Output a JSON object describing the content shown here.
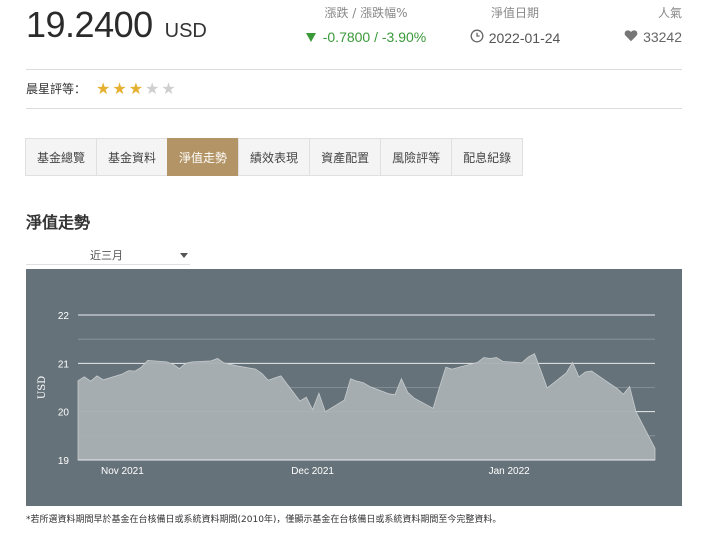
{
  "header": {
    "price": "19.2400",
    "currency": "USD",
    "change_label": "漲跌 / 漲跌幅%",
    "change_value": "-0.7800 / -3.90%",
    "date_label": "淨值日期",
    "date_value": "2022-01-24",
    "popularity_label": "人氣",
    "popularity_value": "33242"
  },
  "rating": {
    "label": "晨星評等：",
    "stars": 3,
    "max_stars": 5
  },
  "tabs": [
    {
      "label": "基金總覽",
      "active": false
    },
    {
      "label": "基金資料",
      "active": false
    },
    {
      "label": "淨值走勢",
      "active": true
    },
    {
      "label": "績效表現",
      "active": false
    },
    {
      "label": "資產配置",
      "active": false
    },
    {
      "label": "風險評等",
      "active": false
    },
    {
      "label": "配息紀錄",
      "active": false
    }
  ],
  "section_title": "淨值走勢",
  "range_select": {
    "value": "近三月"
  },
  "footnote": "*若所選資料期間早於基金在台核備日或系統資料期間(2010年)，僅顯示基金在台核備日或系統資料期間至今完整資料。",
  "colors": {
    "accent": "#b39466",
    "chart_bg": "#667279",
    "area_fill": "#a9b0b4",
    "up_down_green": "#3a9a3a",
    "star_on": "#e6b030"
  },
  "chart_data": {
    "type": "area",
    "ylabel": "USD",
    "ylim": [
      19,
      22
    ],
    "y_ticks": [
      19,
      20,
      21,
      22
    ],
    "x_tick_labels": [
      {
        "label": "Nov 2021",
        "date": "2021-11-01"
      },
      {
        "label": "Dec 2021",
        "date": "2021-12-01"
      },
      {
        "label": "Jan 2022",
        "date": "2022-01-01"
      }
    ],
    "x_range": [
      "2021-10-25",
      "2022-01-24"
    ],
    "grid": true,
    "series": [
      {
        "x": [
          "2021-10-25",
          "2021-10-26",
          "2021-10-27",
          "2021-10-28",
          "2021-10-29",
          "2021-11-01",
          "2021-11-02",
          "2021-11-03",
          "2021-11-04",
          "2021-11-05",
          "2021-11-08",
          "2021-11-09",
          "2021-11-10",
          "2021-11-11",
          "2021-11-12",
          "2021-11-15",
          "2021-11-16",
          "2021-11-17",
          "2021-11-18",
          "2021-11-19",
          "2021-11-22",
          "2021-11-23",
          "2021-11-24",
          "2021-11-26",
          "2021-11-29",
          "2021-11-30",
          "2021-12-01",
          "2021-12-02",
          "2021-12-03",
          "2021-12-06",
          "2021-12-07",
          "2021-12-08",
          "2021-12-09",
          "2021-12-10",
          "2021-12-13",
          "2021-12-14",
          "2021-12-15",
          "2021-12-16",
          "2021-12-17",
          "2021-12-20",
          "2021-12-21",
          "2021-12-22",
          "2021-12-23",
          "2021-12-27",
          "2021-12-28",
          "2021-12-29",
          "2021-12-30",
          "2021-12-31",
          "2022-01-03",
          "2022-01-04",
          "2022-01-05",
          "2022-01-06",
          "2022-01-07",
          "2022-01-10",
          "2022-01-11",
          "2022-01-12",
          "2022-01-13",
          "2022-01-14",
          "2022-01-18",
          "2022-01-19",
          "2022-01-20",
          "2022-01-21",
          "2022-01-24"
        ],
        "values": [
          20.64,
          20.72,
          20.63,
          20.74,
          20.66,
          20.78,
          20.85,
          20.84,
          20.92,
          21.06,
          21.03,
          20.98,
          20.89,
          21.0,
          21.03,
          21.05,
          21.1,
          21.01,
          20.98,
          20.95,
          20.88,
          20.79,
          20.65,
          20.74,
          20.22,
          20.3,
          20.04,
          20.38,
          20.0,
          20.24,
          20.68,
          20.63,
          20.6,
          20.52,
          20.37,
          20.35,
          20.68,
          20.4,
          20.28,
          20.07,
          20.5,
          20.92,
          20.88,
          21.02,
          21.12,
          21.1,
          21.12,
          21.04,
          21.01,
          21.13,
          21.2,
          20.85,
          20.49,
          20.8,
          21.02,
          20.72,
          20.82,
          20.84,
          20.48,
          20.36,
          20.52,
          20.0,
          19.24
        ]
      }
    ]
  }
}
